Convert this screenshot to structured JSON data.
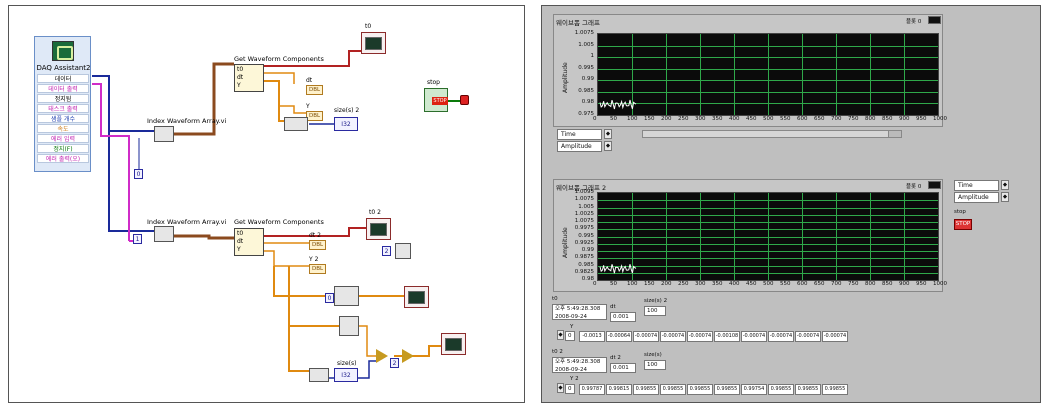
{
  "block_diagram": {
    "daq_assistant": {
      "title": "DAQ Assistant2",
      "terminals": [
        "데이터",
        "데이터 출력",
        "정지됨",
        "태스크 출력",
        "샘플 개수",
        "속도",
        "에러 입력",
        "정지(F)",
        "에러 출력(오)"
      ]
    },
    "index_waveform_1": "Index Waveform Array.vi",
    "index_waveform_2": "Index Waveform Array.vi",
    "get_waveform_1": "Get Waveform Components",
    "get_waveform_2": "Get Waveform Components",
    "get_waveform_1_terms": [
      "t0",
      "dt",
      "Y"
    ],
    "get_waveform_2_terms": [
      "t0",
      "dt",
      "Y"
    ],
    "index_const_1": "0",
    "index_const_2": "1",
    "graph_1_label": "t0",
    "graph_2_label": "t0 2",
    "dt_label_1": "dt",
    "dt_label_2": "dt 2",
    "y_label_1": "Y",
    "y_label_2": "Y 2",
    "size_label_1": "size(s) 2",
    "size_label_2": "size(s)",
    "dbl": "DBL",
    "i32": "I32",
    "const_two": "2",
    "stop_label": "stop",
    "stop_button": "STOP"
  },
  "front_panel": {
    "chart_1": {
      "title": "웨이브폼 그래프",
      "plot_label": "플롯 0",
      "ylabel": "Amplitude",
      "yticks": [
        "1.0075",
        "1.005",
        "1",
        "0.995",
        "0.99",
        "0.985",
        "0.98",
        "0.975"
      ],
      "xticks": [
        "0",
        "50",
        "100",
        "150",
        "200",
        "250",
        "300",
        "350",
        "400",
        "450",
        "500",
        "550",
        "600",
        "650",
        "700",
        "750",
        "800",
        "850",
        "900",
        "950",
        "1000"
      ],
      "legend": [
        "Time",
        "Amplitude"
      ]
    },
    "chart_2": {
      "title": "웨이브폼 그래프 2",
      "plot_label": "플롯 0",
      "ylabel": "Amplitude",
      "yticks": [
        "1.0095",
        "1.0075",
        "1.005",
        "1.0025",
        "1.0075",
        "0.9975",
        "0.995",
        "0.9925",
        "0.99",
        "0.9875",
        "0.985",
        "0.9825",
        "0.98"
      ],
      "xticks": [
        "0",
        "50",
        "100",
        "150",
        "200",
        "250",
        "300",
        "350",
        "400",
        "450",
        "500",
        "550",
        "600",
        "650",
        "700",
        "750",
        "800",
        "850",
        "900",
        "950",
        "1000"
      ],
      "legend": [
        "Time",
        "Amplitude"
      ]
    },
    "stop_label": "stop",
    "stop_button": "STOP",
    "cluster_1": {
      "t0_label": "t0",
      "t0_value": "오후 5:49:28.308",
      "t0_date": "2008-09-24",
      "dt_label": "dt",
      "dt_value": "0.001",
      "size_label": "size(s) 2",
      "size_value": "100",
      "y_label": "Y",
      "index": "0",
      "values": [
        "-0.0013",
        "-0.00064",
        "-0.00074",
        "-0.00074",
        "-0.00074",
        "-0.00108",
        "-0.00074",
        "-0.00074",
        "-0.00074",
        "-0.00074"
      ]
    },
    "cluster_2": {
      "t0_label": "t0 2",
      "t0_value": "오후 5:49:28.308",
      "t0_date": "2008-09-24",
      "dt_label": "dt 2",
      "dt_value": "0.001",
      "size_label": "size(s)",
      "size_value": "100",
      "y_label": "Y 2",
      "index": "0",
      "values": [
        "0.99787",
        "0.99815",
        "0.99855",
        "0.99855",
        "0.99855",
        "0.99855",
        "0.99754",
        "0.99855",
        "0.99855",
        "0.99855"
      ]
    }
  }
}
